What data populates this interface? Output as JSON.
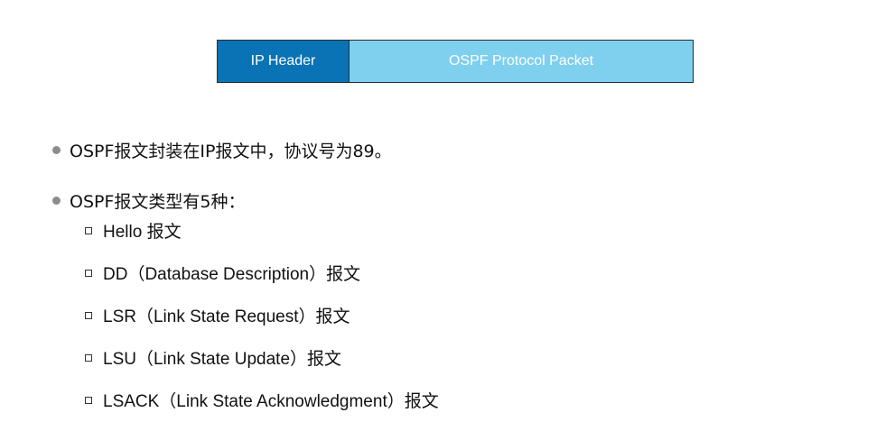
{
  "packet": {
    "ip_header": "IP Header",
    "ospf_packet": "OSPF Protocol Packet"
  },
  "bullets": [
    "OSPF报文封装在IP报文中，协议号为89。",
    "OSPF报文类型有5种："
  ],
  "packet_types": [
    "Hello 报文",
    "DD（Database Description）报文",
    "LSR（Link State Request）报文",
    "LSU（Link State Update）报文",
    "LSACK（Link State Acknowledgment）报文"
  ],
  "colors": {
    "ip_header_fill": "#0a73b5",
    "ospf_packet_fill": "#7fcfee"
  }
}
